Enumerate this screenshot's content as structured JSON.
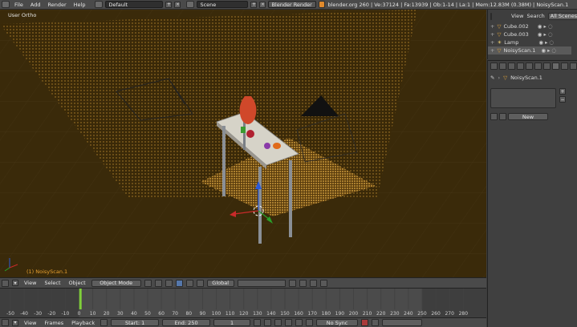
{
  "top": {
    "menus": [
      "File",
      "Add",
      "Render",
      "Help"
    ],
    "layout": "Default",
    "scene": "Scene",
    "engine": "Blender Render",
    "stats": "blender.org 260 | Ve:37124 | Fa:13939 | Ob:1-14 | La:1 | Mem:12.83M (0.38M) | NoisyScan.1"
  },
  "viewport": {
    "view_label": "User Ortho",
    "object_label": "(1) NoisyScan.1"
  },
  "outliner": {
    "view": "View",
    "search": "Search",
    "all_scenes": "All Scenes",
    "items": [
      {
        "name": "Cube.002"
      },
      {
        "name": "Cube.003"
      },
      {
        "name": "Lamp"
      },
      {
        "name": "NoisyScan.1"
      }
    ]
  },
  "props": {
    "breadcrumb": "NoisyScan.1",
    "new_label": "New"
  },
  "vp_header": {
    "view": "View",
    "select": "Select",
    "object": "Object",
    "mode": "Object Mode",
    "orientation": "Global"
  },
  "timeline": {
    "ticks": [
      "-50",
      "-40",
      "-30",
      "-20",
      "-10",
      "0",
      "10",
      "20",
      "30",
      "40",
      "50",
      "60",
      "70",
      "80",
      "90",
      "100",
      "110",
      "120",
      "130",
      "140",
      "150",
      "160",
      "170",
      "180",
      "190",
      "200",
      "210",
      "220",
      "230",
      "240",
      "250",
      "260",
      "270",
      "280"
    ],
    "current_frame_value": 1
  },
  "tl_header": {
    "view": "View",
    "frames": "Frames",
    "playback": "Playback",
    "start": "Start: 1",
    "end": "End: 250",
    "current": "1",
    "sync": "No Sync"
  }
}
